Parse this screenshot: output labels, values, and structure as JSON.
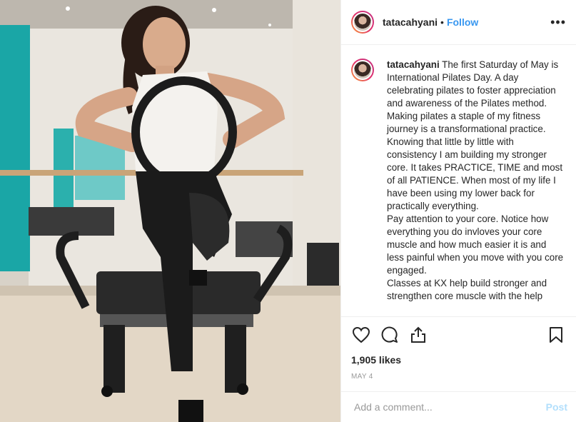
{
  "post": {
    "username": "tatacahyani",
    "dot": "•",
    "follow_label": "Follow",
    "more_label": "•••",
    "caption_user": "tatacahyani",
    "caption_paragraphs": [
      "The first Saturday of May is International Pilates Day. A day celebrating pilates to foster appreciation and awareness of the Pilates method.",
      "Making pilates a staple of my fitness journey is a transformational practice. Knowing that little by little with consistency I am building my stronger core. It takes PRACTICE, TIME and most of all PATIENCE. When most of my life I have been using my lower back for practically everything.",
      "Pay attention to your core. Notice how everything you do invloves your core muscle and how much easier it is and less painful when you move with you core engaged.",
      "Classes at KX help build stronger and strengthen core muscle with the help"
    ],
    "likes": "1,905 likes",
    "date": "MAY 4",
    "comment_placeholder": "Add a comment...",
    "post_label": "Post"
  },
  "icons": {
    "like": "heart-icon",
    "comment": "comment-bubble-icon",
    "share": "share-icon",
    "save": "bookmark-icon",
    "more": "more-options-icon"
  },
  "colors": {
    "accent": "#3897f0",
    "post_disabled": "#b2dffc",
    "border": "#efefef",
    "muted": "#999999",
    "text": "#262626"
  }
}
